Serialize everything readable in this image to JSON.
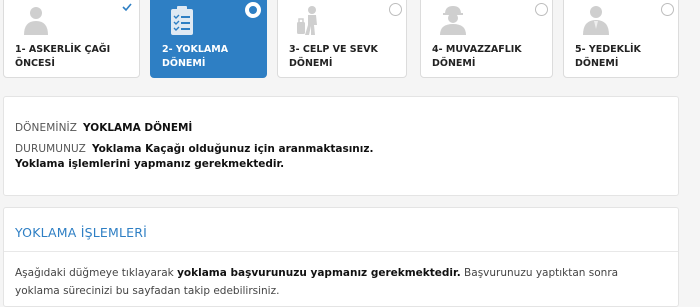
{
  "steps": [
    {
      "label_line1": "1- ASKERLİK ÇAĞI",
      "label_line2": "ÖNCESİ",
      "icon": "person-silhouette-icon",
      "state": "completed"
    },
    {
      "label_line1": "2- YOKLAMA",
      "label_line2": "DÖNEMİ",
      "icon": "clipboard-checklist-icon",
      "state": "active"
    },
    {
      "label_line1": "3- CELP VE SEVK",
      "label_line2": "DÖNEMİ",
      "icon": "traveler-with-luggage-icon",
      "state": "inactive"
    },
    {
      "label_line1": "4- MUVAZZAFLIK",
      "label_line2": "DÖNEMİ",
      "icon": "soldier-helmet-icon",
      "state": "inactive"
    },
    {
      "label_line1": "5- YEDEKLİK",
      "label_line2": "DÖNEMİ",
      "icon": "civilian-person-icon",
      "state": "inactive"
    }
  ],
  "status": {
    "period_label": "DÖNEMİNİZ",
    "period_value": "YOKLAMA DÖNEMİ",
    "state_label": "DURUMUNUZ",
    "state_line1": "Yoklama Kaçağı olduğunuz için aranmaktasınız.",
    "state_line2": "Yoklama işlemlerini yapmanız gerekmektedir."
  },
  "operations": {
    "title": "YOKLAMA İŞLEMLERİ",
    "text_part1": "Aşağıdaki düğmeye tıklayarak ",
    "text_bold": "yoklama başvurunuzu yapmanız gerekmektedir.",
    "text_part2": " Başvurunuzu yaptıktan sonra yoklama sürecinizi bu sayfadan takip edebilirsiniz."
  },
  "colors": {
    "accent": "#2e7fc4",
    "icon_gray": "#cfcfcf"
  }
}
